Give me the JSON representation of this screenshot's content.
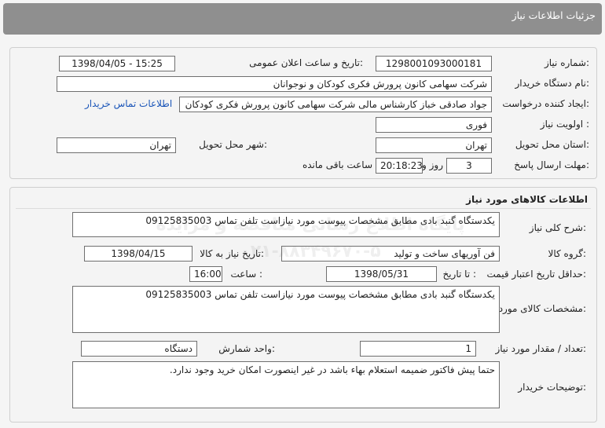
{
  "header": {
    "title": "جزئیات اطلاعات نیاز"
  },
  "info": {
    "need_number_label": "شماره نیاز:",
    "need_number": "1298001093000181",
    "announce_label": "تاریخ و ساعت اعلان عمومی:",
    "announce_value": "1398/04/05 - 15:25",
    "buyer_label": "نام دستگاه خریدار:",
    "buyer_value": "شرکت سهامی کانون پرورش فکری کودکان و نوجوانان",
    "creator_label": "ایجاد کننده درخواست:",
    "creator_value": "جواد  صادقی خباز کارشناس مالی شرکت سهامی کانون پرورش فکری کودکان",
    "contact_link": "اطلاعات تماس خریدار",
    "priority_label": "اولویت نیاز :",
    "priority_value": "فوری",
    "province_label": "استان محل تحویل:",
    "province_value": "تهران",
    "city_label": "شهر محل تحویل:",
    "city_value": "تهران",
    "deadline_label": "مهلت ارسال پاسخ:",
    "days_value": "3",
    "days_text": "روز و",
    "time_value": "20:18:23",
    "remaining_text": "ساعت باقی مانده"
  },
  "goods": {
    "section_title": "اطلاعات کالاهای مورد نیاز",
    "summary_label": "شرح کلی نیاز:",
    "summary_value": "یکدستگاه گنبد بادی مطابق مشخصات پیوست مورد نیازاست تلفن تماس 09125835003",
    "group_label": "گروه کالا:",
    "group_value": "فن آوریهای ساخت و تولید",
    "need_date_label": "تاریخ نیاز به کالا:",
    "need_date_value": "1398/04/15",
    "validity_label": "حداقل تاریخ اعتبار قیمت:",
    "until_date_label": "تا تاریخ :",
    "until_date_value": "1398/05/31",
    "time_label": "ساعت :",
    "time_value": "16:00",
    "spec_label": "مشخصات کالای مورد نیاز:",
    "spec_value": "یکدستگاه گنبد بادی مطابق مشخصات پیوست مورد نیازاست تلفن تماس 09125835003",
    "qty_label": "تعداد / مقدار مورد نیاز:",
    "qty_value": "1",
    "unit_label": "واحد شمارش:",
    "unit_value": "دستگاه",
    "notes_label": "توضیحات خریدار:",
    "notes_value": "حتما پیش فاکتور ضمیمه استعلام بهاء باشد در غیر اینصورت امکان خرید وجود ندارد."
  },
  "watermark": {
    "line1": "پایگاه اطلاع رسانی مناقصه و مزایده",
    "line2": "۰۲۱-۸۸۳۴۹۶۷۰-۵"
  }
}
